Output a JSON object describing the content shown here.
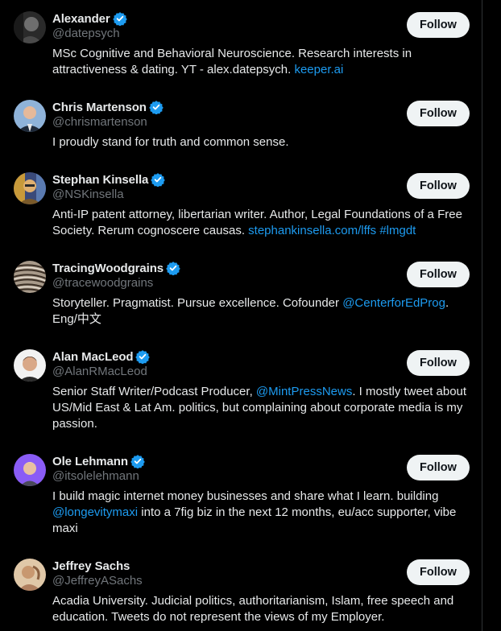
{
  "follow_label": "Follow",
  "colors": {
    "accent": "#1d9bf0",
    "background": "#000000",
    "text": "#e7e9ea",
    "muted": "#71767b",
    "button_bg": "#eff3f4"
  },
  "accounts": [
    {
      "name": "Alexander",
      "handle": "@datepsych",
      "avatar_icon": "dark-portrait-avatar",
      "bio": [
        {
          "text": "MSc Cognitive and Behavioral Neuroscience. Research interests in attractiveness & dating. YT - alex.datepsych. "
        },
        {
          "text": "keeper.ai",
          "link": true
        }
      ]
    },
    {
      "name": "Chris Martenson",
      "handle": "@chrismartenson",
      "avatar_icon": "man-in-suit-avatar",
      "bio": [
        {
          "text": "I proudly stand for truth and common sense."
        }
      ]
    },
    {
      "name": "Stephan Kinsella",
      "handle": "@NSKinsella",
      "avatar_icon": "painted-portrait-avatar",
      "bio": [
        {
          "text": "Anti-IP patent attorney, libertarian writer. Author, Legal Foundations of a Free Society. Rerum cognoscere causas. "
        },
        {
          "text": "stephankinsella.com/lffs",
          "link": true
        },
        {
          "text": " "
        },
        {
          "text": "#lmgdt",
          "link": true
        }
      ]
    },
    {
      "name": "TracingWoodgrains",
      "handle": "@tracewoodgrains",
      "avatar_icon": "wood-grain-avatar",
      "bio": [
        {
          "text": "Storyteller. Pragmatist. Pursue excellence. Cofounder "
        },
        {
          "text": "@CenterforEdProg",
          "link": true
        },
        {
          "text": ". Eng/中文"
        }
      ]
    },
    {
      "name": "Alan MacLeod",
      "handle": "@AlanRMacLeod",
      "avatar_icon": "man-headshot-avatar",
      "bio": [
        {
          "text": "Senior Staff Writer/Podcast Producer, "
        },
        {
          "text": "@MintPressNews",
          "link": true
        },
        {
          "text": ". I mostly tweet about US/Mid East & Lat Am. politics, but complaining about corporate media is my passion."
        }
      ]
    },
    {
      "name": "Ole Lehmann",
      "handle": "@itsolelehmann",
      "avatar_icon": "purple-background-avatar",
      "bio": [
        {
          "text": "I build magic internet money businesses and share what I learn. building "
        },
        {
          "text": "@longevitymaxi",
          "link": true
        },
        {
          "text": " into a 7fig biz in the next 12 months, eu/acc supporter, vibe maxi"
        }
      ]
    },
    {
      "name": "Jeffrey Sachs",
      "handle": "@JeffreyASachs",
      "avatar_icon": "sculpture-avatar",
      "bio": [
        {
          "text": "Acadia University. Judicial politics, authoritarianism, Islam, free speech and education. Tweets do not represent the views of my Employer."
        }
      ]
    }
  ]
}
